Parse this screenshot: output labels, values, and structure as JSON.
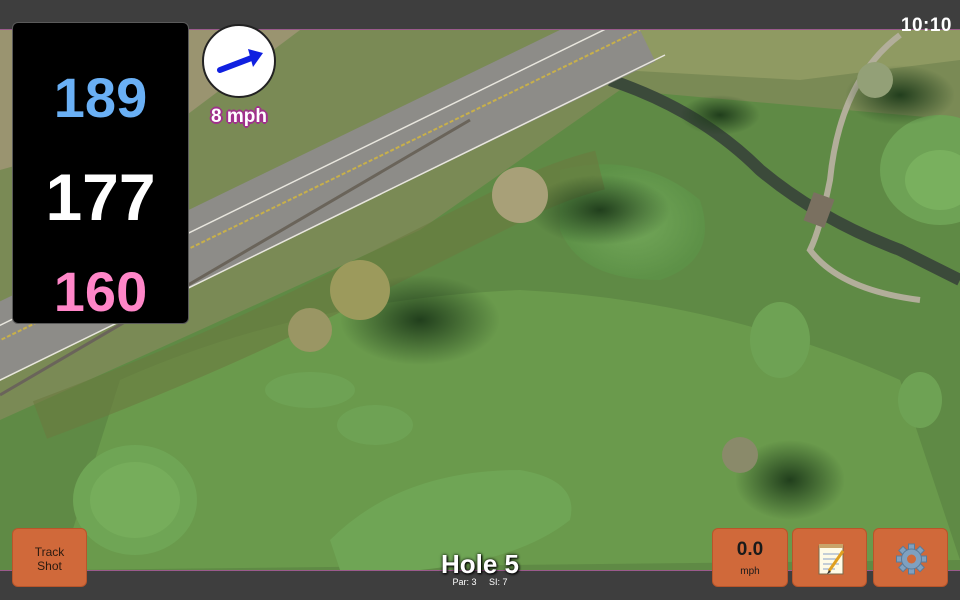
{
  "status": {
    "time": "10:10"
  },
  "yardages": {
    "back": "189",
    "center": "177",
    "front": "160"
  },
  "wind": {
    "speed_label": "8 mph",
    "direction_icon": "arrow-east-northeast-icon",
    "arrow_color": "#1020e0"
  },
  "hole": {
    "title": "Hole 5",
    "par_label": "Par: 3",
    "si_label": "SI: 7"
  },
  "buttons": {
    "track_shot_line1": "Track",
    "track_shot_line2": "Shot",
    "speed_value": "0.0",
    "speed_unit": "mph",
    "notes_icon": "notepad-icon",
    "settings_icon": "gear-icon"
  },
  "colors": {
    "back_yardage": "#6ab0f5",
    "center_yardage": "#ffffff",
    "front_yardage": "#ff86c8",
    "button": "#d0693a",
    "bar_accent": "#9a5a8c"
  }
}
